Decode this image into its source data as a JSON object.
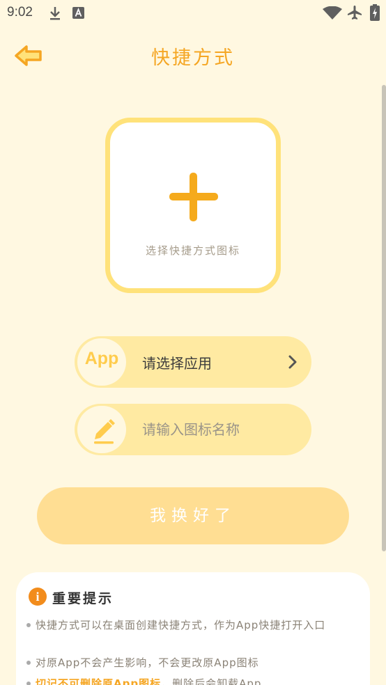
{
  "status_bar": {
    "time": "9:02",
    "icons": [
      "download-icon",
      "a-notification-icon",
      "wifi-icon",
      "airplane-icon",
      "battery-charging-icon"
    ]
  },
  "header": {
    "back_icon": "back-arrow-icon",
    "title": "快捷方式"
  },
  "icon_picker": {
    "icon": "plus-icon",
    "label": "选择快捷方式图标"
  },
  "app_select": {
    "badge": "App",
    "label": "请选择应用",
    "icon": "chevron-right-icon"
  },
  "name_input": {
    "icon": "pencil-icon",
    "placeholder": "请输入图标名称",
    "value": ""
  },
  "submit_button": {
    "label": "我换好了"
  },
  "tips": {
    "icon": "info-icon",
    "title": "重要提示",
    "items": [
      "快捷方式可以在桌面创建快捷方式，作为App快捷打开入口",
      "对原App不会产生影响，不会更改原App图标"
    ],
    "warning": {
      "highlight": "切记不可删除原App图标",
      "rest": "，删除后会卸载App"
    }
  },
  "colors": {
    "background": "#fff8e1",
    "accent": "#f5a623",
    "pill": "#ffeaa2",
    "button": "#ffde93",
    "picker_border": "#ffe27a"
  }
}
